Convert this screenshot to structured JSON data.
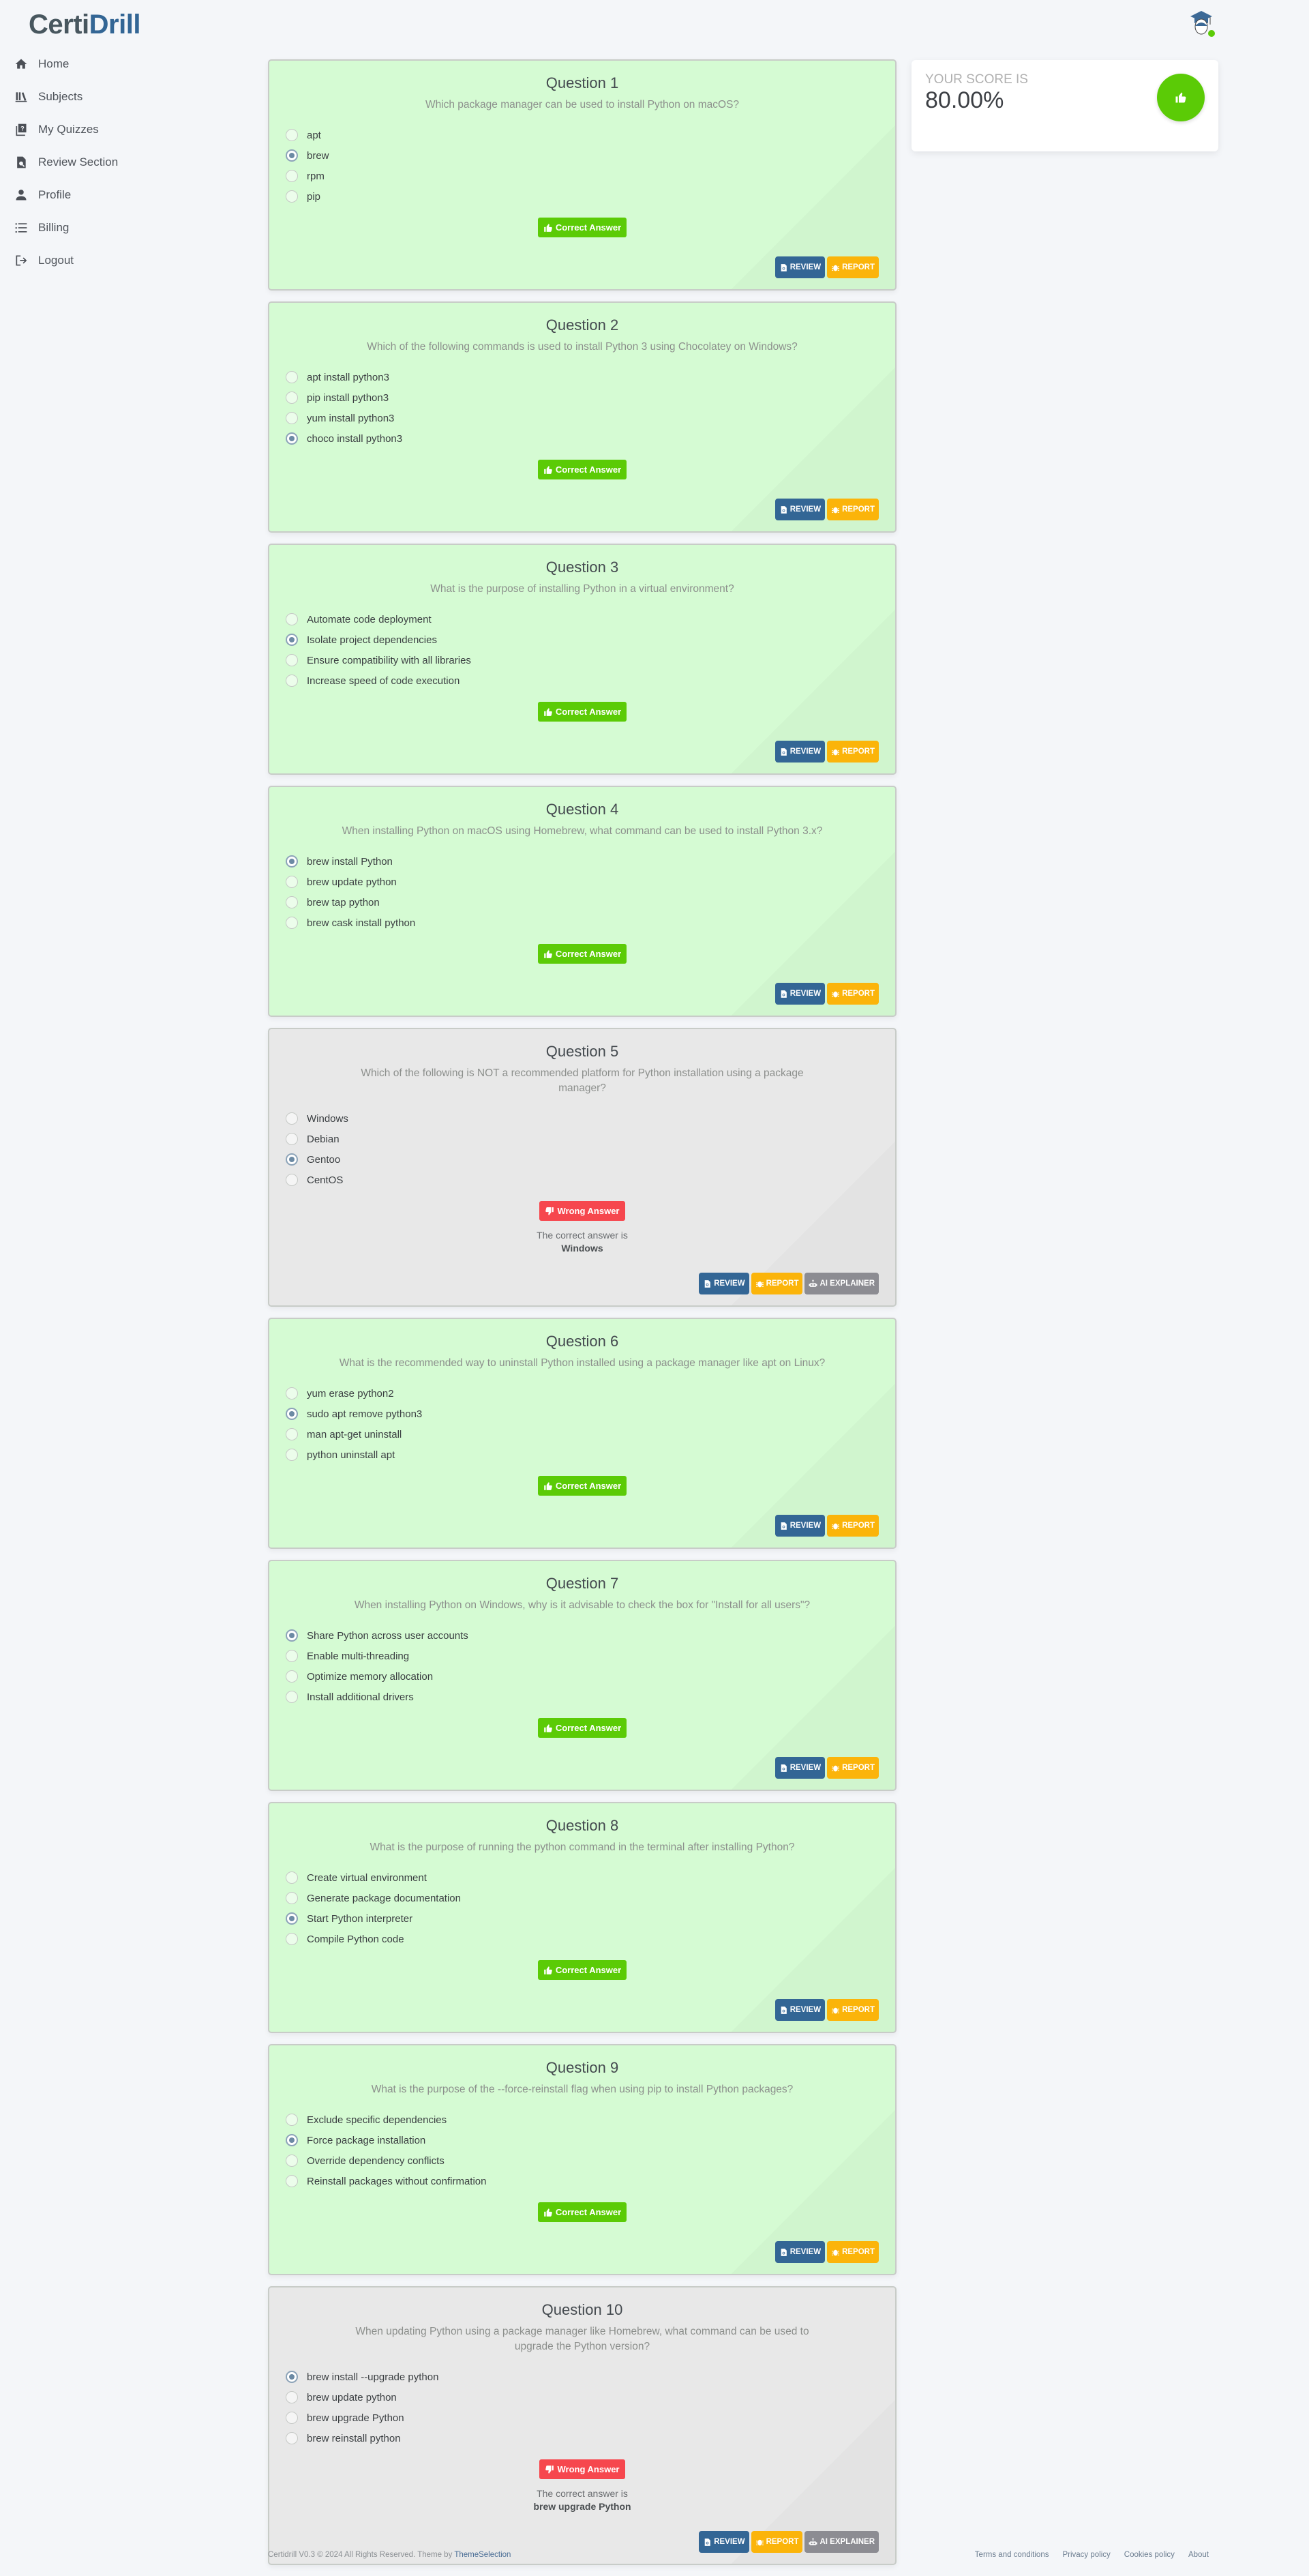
{
  "app": {
    "logo_part1": "Certi",
    "logo_part2": "Drill"
  },
  "sidebar": {
    "items": [
      {
        "label": "Home",
        "icon": "home-icon"
      },
      {
        "label": "Subjects",
        "icon": "books-icon"
      },
      {
        "label": "My Quizzes",
        "icon": "quiz-icon"
      },
      {
        "label": "Review Section",
        "icon": "file-search-icon"
      },
      {
        "label": "Profile",
        "icon": "user-icon"
      },
      {
        "label": "Billing",
        "icon": "list-icon"
      },
      {
        "label": "Logout",
        "icon": "logout-icon"
      }
    ]
  },
  "user": {
    "avatar_icon": "graduate-avatar-icon",
    "status": "online",
    "status_color": "#5bcb06"
  },
  "score": {
    "label": "YOUR SCORE IS",
    "value": "80.00%",
    "badge_icon": "thumbs-up-icon"
  },
  "labels": {
    "correct_answer": "Correct Answer",
    "wrong_answer": "Wrong Answer",
    "correct_answer_is": "The correct answer is",
    "review": "REVIEW",
    "report": "REPORT",
    "ai_explainer": "AI EXPLAINER"
  },
  "colors": {
    "correct_card_bg": "#d5fbd3",
    "wrong_card_bg": "#e8e8e8",
    "correct_badge": "#5bcb06",
    "wrong_badge": "#f6474e",
    "review_button": "#336695",
    "report_button": "#fbb40a",
    "ai_button": "#8c8c92",
    "brand_blue": "#336695"
  },
  "questions": [
    {
      "title": "Question 1",
      "text": "Which package manager can be used to install Python on macOS?",
      "options": [
        "apt",
        "brew",
        "rpm",
        "pip"
      ],
      "selected": 1,
      "status": "correct"
    },
    {
      "title": "Question 2",
      "text": "Which of the following commands is used to install Python 3 using Chocolatey on Windows?",
      "options": [
        "apt install python3",
        "pip install python3",
        "yum install python3",
        "choco install python3"
      ],
      "selected": 3,
      "status": "correct"
    },
    {
      "title": "Question 3",
      "text": "What is the purpose of installing Python in a virtual environment?",
      "options": [
        "Automate code deployment",
        "Isolate project dependencies",
        "Ensure compatibility with all libraries",
        "Increase speed of code execution"
      ],
      "selected": 1,
      "status": "correct"
    },
    {
      "title": "Question 4",
      "text": "When installing Python on macOS using Homebrew, what command can be used to install Python 3.x?",
      "options": [
        "brew install Python",
        "brew update python",
        "brew tap python",
        "brew cask install python"
      ],
      "selected": 0,
      "status": "correct"
    },
    {
      "title": "Question 5",
      "text": "Which of the following is NOT a recommended platform for Python installation using a package manager?",
      "options": [
        "Windows",
        "Debian",
        "Gentoo",
        "CentOS"
      ],
      "selected": 2,
      "status": "wrong",
      "correct_answer": "Windows"
    },
    {
      "title": "Question 6",
      "text": "What is the recommended way to uninstall Python installed using a package manager like apt on Linux?",
      "options": [
        "yum erase python2",
        "sudo apt remove python3",
        "man apt-get uninstall",
        "python uninstall apt"
      ],
      "selected": 1,
      "status": "correct"
    },
    {
      "title": "Question 7",
      "text": "When installing Python on Windows, why is it advisable to check the box for \"Install for all users\"?",
      "options": [
        "Share Python across user accounts",
        "Enable multi-threading",
        "Optimize memory allocation",
        "Install additional drivers"
      ],
      "selected": 0,
      "status": "correct"
    },
    {
      "title": "Question 8",
      "text": "What is the purpose of running the python command in the terminal after installing Python?",
      "options": [
        "Create virtual environment",
        "Generate package documentation",
        "Start Python interpreter",
        "Compile Python code"
      ],
      "selected": 2,
      "status": "correct"
    },
    {
      "title": "Question 9",
      "text": "What is the purpose of the --force-reinstall flag when using pip to install Python packages?",
      "options": [
        "Exclude specific dependencies",
        "Force package installation",
        "Override dependency conflicts",
        "Reinstall packages without confirmation"
      ],
      "selected": 1,
      "status": "correct"
    },
    {
      "title": "Question 10",
      "text": "When updating Python using a package manager like Homebrew, what command can be used to upgrade the Python version?",
      "options": [
        "brew install --upgrade python",
        "brew update python",
        "brew upgrade Python",
        "brew reinstall python"
      ],
      "selected": 0,
      "status": "wrong",
      "correct_answer": "brew upgrade Python"
    }
  ],
  "footer": {
    "copyright": "Certidrill V0.3 © 2024 All Rights Reserved. Theme by ",
    "theme_link": "ThemeSelection",
    "links": [
      "Terms and conditions",
      "Privacy policy",
      "Cookies policy",
      "About"
    ]
  }
}
